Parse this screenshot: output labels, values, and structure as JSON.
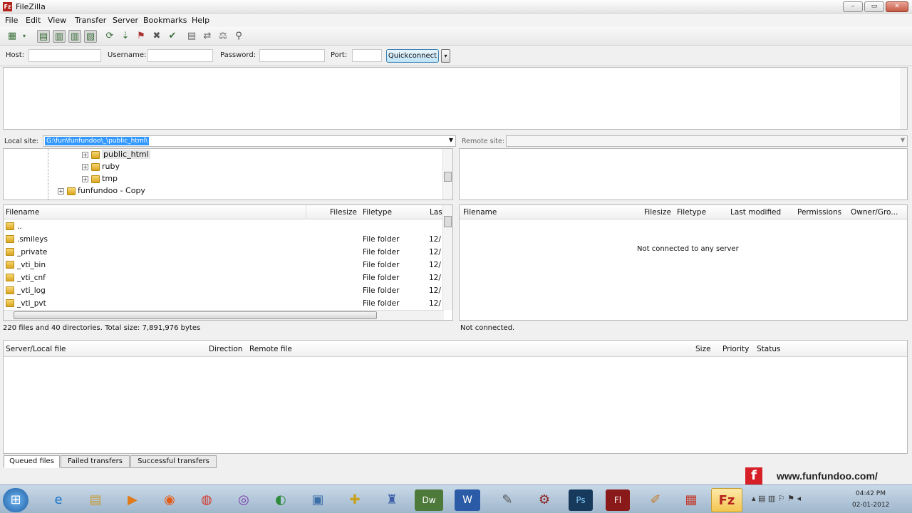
{
  "window": {
    "title": "FileZilla",
    "app_icon": "filezilla-icon",
    "controls": [
      "–",
      "▭",
      "✕"
    ]
  },
  "menu": [
    "File",
    "Edit",
    "View",
    "Transfer",
    "Server",
    "Bookmarks",
    "Help"
  ],
  "quickconnect": {
    "host_label": "Host:",
    "host_value": "",
    "username_label": "Username:",
    "username_value": "",
    "password_label": "Password:",
    "password_value": "",
    "port_label": "Port:",
    "port_value": "",
    "button": "Quickconnect"
  },
  "local": {
    "site_label": "Local site:",
    "path": "G:\\fun\\funfundoo\\_\\public_html\\",
    "tree": [
      "public_html",
      "ruby",
      "tmp",
      "funfundoo - Copy"
    ],
    "columns": [
      "Filename",
      "Filesize",
      "Filetype",
      "Last"
    ],
    "files": [
      {
        "name": "..",
        "type": "",
        "date": ""
      },
      {
        "name": ".smileys",
        "type": "File folder",
        "date": "12/"
      },
      {
        "name": "_private",
        "type": "File folder",
        "date": "12/"
      },
      {
        "name": "_vti_bin",
        "type": "File folder",
        "date": "12/"
      },
      {
        "name": "_vti_cnf",
        "type": "File folder",
        "date": "12/"
      },
      {
        "name": "_vti_log",
        "type": "File folder",
        "date": "12/"
      },
      {
        "name": "_vti_pvt",
        "type": "File folder",
        "date": "12/"
      }
    ],
    "status": "220 files and 40 directories. Total size: 7,891,976 bytes"
  },
  "remote": {
    "site_label": "Remote site:",
    "path": "",
    "columns": [
      "Filename",
      "Filesize",
      "Filetype",
      "Last modified",
      "Permissions",
      "Owner/Gro..."
    ],
    "empty_message": "Not connected to any server",
    "status": "Not connected."
  },
  "queue": {
    "columns": [
      "Server/Local file",
      "Direction",
      "Remote file",
      "Size",
      "Priority",
      "Status"
    ],
    "tabs": [
      "Queued files",
      "Failed transfers",
      "Successful transfers"
    ]
  },
  "watermark": "www.funfundoo.com/",
  "clock": {
    "time": "04:42 PM",
    "date": "02-01-2012"
  },
  "colors": {
    "selection": "#3399ff",
    "quickconnect": "#bde3f7",
    "taskbar": "#b3c7db"
  }
}
